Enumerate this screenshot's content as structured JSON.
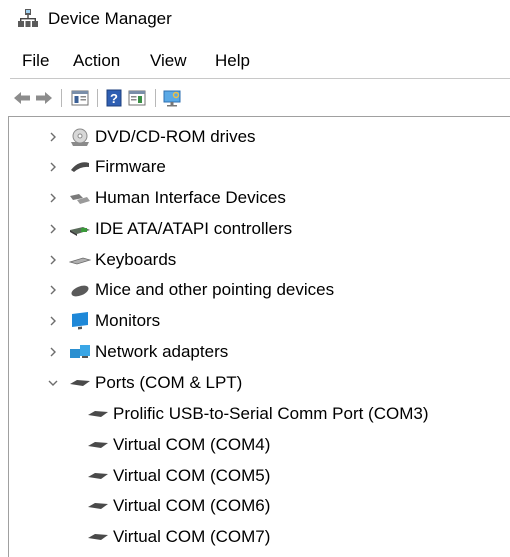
{
  "window": {
    "title": "Device Manager"
  },
  "menu": {
    "file": "File",
    "action": "Action",
    "view": "View",
    "help": "Help"
  },
  "toolbar": {
    "buttons": [
      "back-arrow-icon",
      "forward-arrow-icon",
      "properties-icon",
      "help-icon",
      "details-icon",
      "monitor-scan-icon"
    ]
  },
  "tree": {
    "items": [
      {
        "label": "DVD/CD-ROM drives",
        "icon": "dvd-drive-icon",
        "expanded": false
      },
      {
        "label": "Firmware",
        "icon": "firmware-icon",
        "expanded": false
      },
      {
        "label": "Human Interface Devices",
        "icon": "hid-icon",
        "expanded": false
      },
      {
        "label": "IDE ATA/ATAPI controllers",
        "icon": "ide-controller-icon",
        "expanded": false
      },
      {
        "label": "Keyboards",
        "icon": "keyboard-icon",
        "expanded": false
      },
      {
        "label": "Mice and other pointing devices",
        "icon": "mouse-icon",
        "expanded": false
      },
      {
        "label": "Monitors",
        "icon": "monitor-icon",
        "expanded": false
      },
      {
        "label": "Network adapters",
        "icon": "network-adapter-icon",
        "expanded": false
      },
      {
        "label": "Ports (COM & LPT)",
        "icon": "port-icon",
        "expanded": true
      }
    ],
    "ports_children": [
      {
        "label": "Prolific USB-to-Serial Comm Port (COM3)",
        "icon": "port-icon"
      },
      {
        "label": "Virtual COM (COM4)",
        "icon": "port-icon"
      },
      {
        "label": "Virtual COM (COM5)",
        "icon": "port-icon"
      },
      {
        "label": "Virtual COM (COM6)",
        "icon": "port-icon"
      },
      {
        "label": "Virtual COM (COM7)",
        "icon": "port-icon"
      }
    ]
  },
  "colors": {
    "tree_border": "#a0a0a0",
    "chevron": "#6d6d6d",
    "monitor_blue": "#1e88d8"
  }
}
